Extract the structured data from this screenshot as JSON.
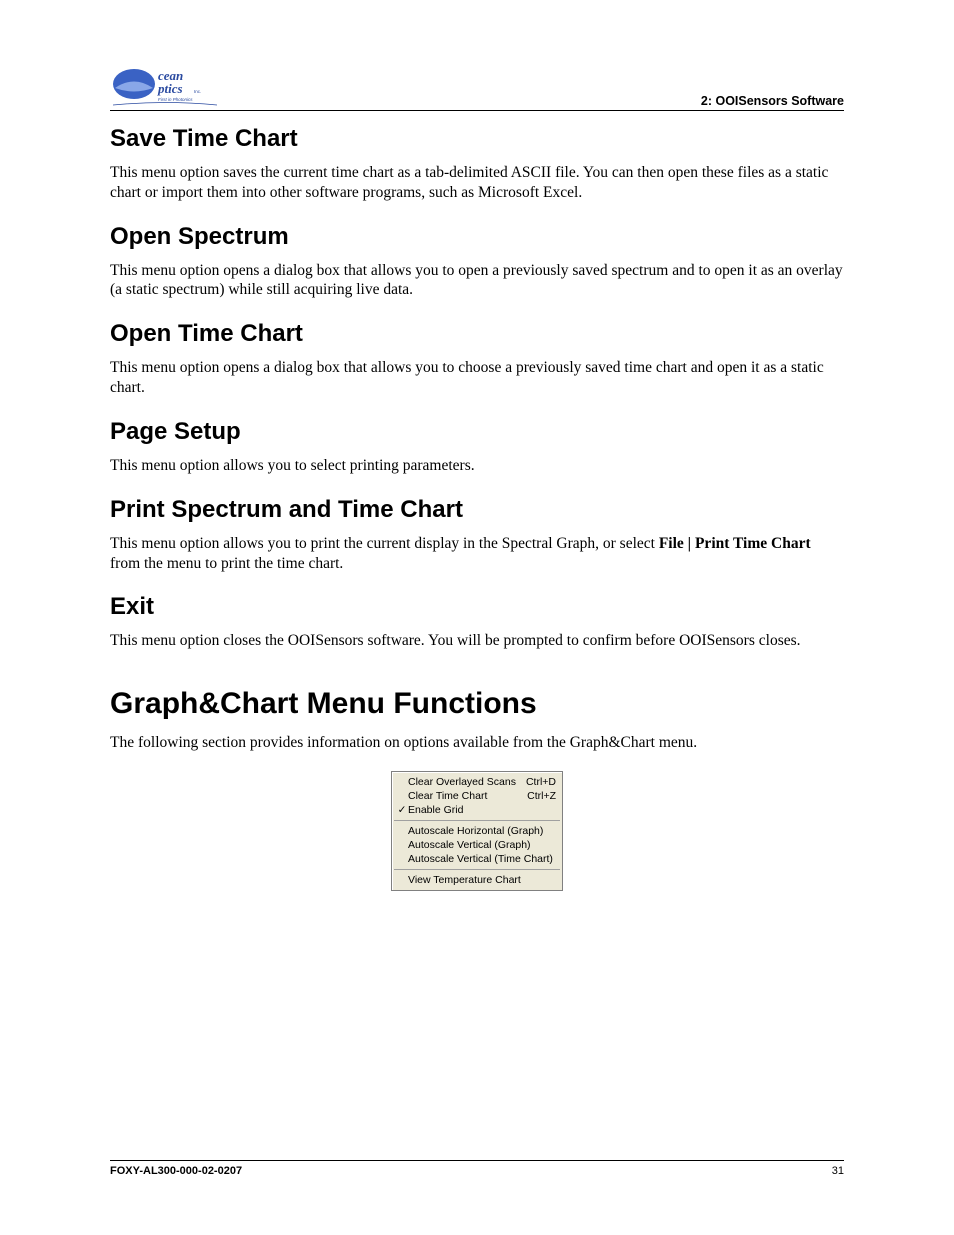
{
  "header": {
    "right": "2: OOISensors Software"
  },
  "sections": {
    "save_time_chart": {
      "title": "Save Time Chart",
      "body": "This menu option saves the current time chart as a tab-delimited ASCII file. You can then open these files as a static chart or import them into other software programs, such as Microsoft Excel."
    },
    "open_spectrum": {
      "title": "Open Spectrum",
      "body": "This menu option opens a dialog box that allows you to open a previously saved spectrum and to open it as an overlay (a static spectrum) while still acquiring live data."
    },
    "open_time_chart": {
      "title": "Open Time Chart",
      "body": "This menu option opens a dialog box that allows you to choose a previously saved time chart and open it as a static chart."
    },
    "page_setup": {
      "title": "Page Setup",
      "body": "This menu option allows you to select printing parameters."
    },
    "print": {
      "title": "Print Spectrum and Time Chart",
      "body_pre": "This menu option allows you to print the current display in the Spectral Graph, or select ",
      "body_bold": "File | Print Time Chart",
      "body_post": " from the menu to print the time chart."
    },
    "exit": {
      "title": "Exit",
      "body": "This menu option closes the OOISensors software. You will be prompted to confirm before OOISensors closes."
    },
    "graph_chart": {
      "title": "Graph&Chart Menu Functions",
      "body": "The following section provides information on options available from the Graph&Chart menu."
    }
  },
  "menu": {
    "group1": [
      {
        "label": "Clear Overlayed Scans",
        "shortcut": "Ctrl+D",
        "checked": false
      },
      {
        "label": "Clear Time Chart",
        "shortcut": "Ctrl+Z",
        "checked": false
      },
      {
        "label": "Enable Grid",
        "shortcut": "",
        "checked": true
      }
    ],
    "group2": [
      {
        "label": "Autoscale Horizontal (Graph)",
        "shortcut": "",
        "checked": false
      },
      {
        "label": "Autoscale Vertical (Graph)",
        "shortcut": "",
        "checked": false
      },
      {
        "label": "Autoscale Vertical (Time Chart)",
        "shortcut": "",
        "checked": false
      }
    ],
    "group3": [
      {
        "label": "View Temperature Chart",
        "shortcut": "",
        "checked": false
      }
    ]
  },
  "footer": {
    "left": "FOXY-AL300-000-02-0207",
    "right": "31"
  }
}
